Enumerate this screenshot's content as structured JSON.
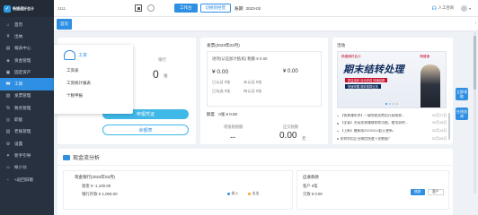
{
  "app": {
    "logo_text": "畅捷通好会计",
    "company": "1111",
    "period_label": "账期",
    "period_value": "2023-02",
    "btn_workbench": "工作台",
    "btn_switch": "切换到经营",
    "customer_service": "人工咨询"
  },
  "sidebar": {
    "items": [
      {
        "label": "首页",
        "icon": "home-icon"
      },
      {
        "label": "出纳",
        "icon": "cashier-icon"
      },
      {
        "label": "報表中心",
        "icon": "report-icon"
      },
      {
        "label": "资金管理",
        "icon": "fund-icon"
      },
      {
        "label": "固定资产",
        "icon": "asset-icon"
      },
      {
        "label": "工资",
        "icon": "salary-icon"
      },
      {
        "label": "发票管理",
        "icon": "invoice-icon"
      },
      {
        "label": "税务管理",
        "icon": "tax-icon"
      },
      {
        "label": "职能",
        "icon": "function-icon"
      },
      {
        "label": "老账管理",
        "icon": "ledger-icon"
      },
      {
        "label": "设置",
        "icon": "settings-icon"
      },
      {
        "label": "新手引导",
        "icon": "guide-icon"
      },
      {
        "label": "帐小伙",
        "icon": "assistant-icon"
      },
      {
        "label": "<返回旧版",
        "icon": "back-icon"
      }
    ],
    "active_index": 5
  },
  "tabs": {
    "home": "首页"
  },
  "salary_menu": {
    "title": "工资",
    "items": [
      "工资表",
      "工资统计报表",
      "个税申报"
    ]
  },
  "tax_card": {
    "col_label": "银行",
    "value": "0",
    "unit": "张",
    "btn_declare": "申报凭证",
    "btn_balance": "余额表"
  },
  "invoice_card": {
    "title": "发票(2023年02月)",
    "subtitle": "进项(认证加计抵扣)  税额 ¥ 0.00",
    "amount": "¥ 0.00",
    "rows": [
      "已认证  0张",
      "未认证  0张",
      "已勾选  0张",
      "待认证  0张"
    ],
    "amount2": "¥ 0.00",
    "quota_label": "额度",
    "quota_value": "0张  ¥ 0.00",
    "foot_left_label": "增值税税额",
    "foot_left_value": "--",
    "foot_right_label": "应交税额",
    "foot_right_value": "0.00",
    "foot_right_unit": "元"
  },
  "activity_card": {
    "title": "活动",
    "banner_brand": "畅捷通好会计",
    "banner_brand2": "畅捷通",
    "banner_headline": "期末结转处理",
    "banner_line1": "损益结转 自动完成 快速结账",
    "banner_line2": "快速掌握 期末核算业务",
    "news": [
      {
        "text": "【快来赚年终】一键领税务费用开具纳税...",
        "date": "02月17日"
      },
      {
        "text": "【全省】关闭发票赚取收款功能，使用说明...",
        "date": "02月15日"
      },
      {
        "text": "【上新】最新版20230114起已更新...",
        "date": "02月14日"
      },
      {
        "text": "如何利用企业微信快速下发数据？",
        "date": "02月09日"
      }
    ]
  },
  "float_buttons": [
    "立即领取",
    "在线咨询"
  ],
  "cash_flow": {
    "title": "现金流分析",
    "left_title": "现金银行(2023年02月)",
    "left_rows": [
      "现金    ¥ -1,100.00",
      "银行存款    ¥ 1,000.00"
    ],
    "legend_in": "收入",
    "legend_out": "支出",
    "right_title": "应收款款",
    "right_rows": [
      "客户  0笔",
      "欠款  ¥ 0.00"
    ],
    "toggle_on": "账龄",
    "toggle_off": "客户"
  },
  "colors": {
    "primary": "#2f8fe3",
    "sidebar_bg": "#28313f",
    "accent_light": "#3fb8e8",
    "legend_in": "#2f8fe3",
    "legend_out": "#f5a623"
  }
}
